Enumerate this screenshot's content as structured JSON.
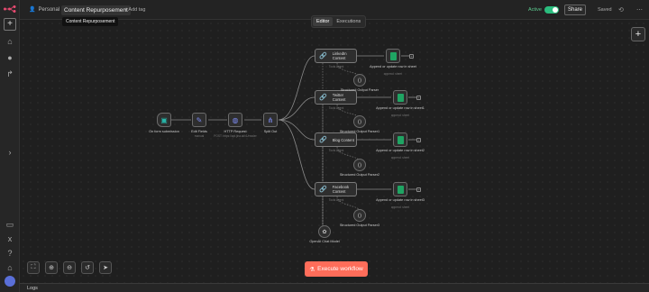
{
  "header": {
    "project": "Personal",
    "workflow_name": "Content Repurposement",
    "tooltip": "Content Repurposement",
    "add_tag": "+ Add tag",
    "active_label": "Active",
    "share_label": "Share",
    "saved_label": "Saved"
  },
  "tabs": [
    {
      "label": "Editor",
      "active": true
    },
    {
      "label": "Executions",
      "active": false
    }
  ],
  "nodes": {
    "trigger": {
      "label": "On form submission",
      "sub": ""
    },
    "edit_fields": {
      "label": "Edit Fields",
      "sub": "manual"
    },
    "http": {
      "label": "HTTP Request",
      "sub": "POST: https://api.jina.ai/v1/reader"
    },
    "split": {
      "label": "Split Out",
      "sub": ""
    },
    "linkedin": {
      "label": "LinkedIn Content",
      "sub": "Tools Agent"
    },
    "twitter": {
      "label": "Twitter Content",
      "sub": "Tools Agent"
    },
    "blog": {
      "label": "Blog Content",
      "sub": "Tools Agent"
    },
    "facebook": {
      "label": "Facebook Content",
      "sub": "Tools Agent"
    },
    "sheet1": {
      "label": "Append or update row in sheet",
      "sub": "append: sheet"
    },
    "sheet2": {
      "label": "Append or update row in sheet1",
      "sub": "append: sheet"
    },
    "sheet3": {
      "label": "Append or update row in sheet2",
      "sub": "append: sheet"
    },
    "sheet4": {
      "label": "Append or update row in sheet3",
      "sub": "append: sheet"
    },
    "parser1": {
      "label": "Structured Output Parser"
    },
    "parser2": {
      "label": "Structured Output Parser1"
    },
    "parser3": {
      "label": "Structured Output Parser2"
    },
    "parser4": {
      "label": "Structured Output Parser3"
    },
    "openai": {
      "label": "OpenAI Chat Model"
    }
  },
  "execute_label": "Execute workflow",
  "logs_label": "Logs",
  "colors": {
    "accent": "#ff6d5a",
    "active": "#2bbd7e",
    "sheets": "#1fa463"
  }
}
